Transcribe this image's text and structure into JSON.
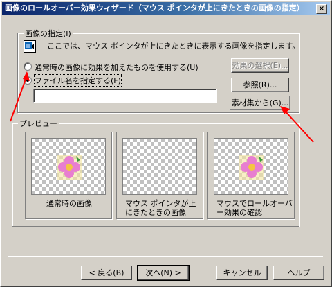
{
  "window": {
    "title": "画像のロールオーバー効果ウィザード（マウス ポインタが上にきたときの画像の指定）",
    "close_glyph": "×"
  },
  "image_spec": {
    "legend": "画像の指定(I)",
    "description": "ここでは、マウス ポインタが上にきたときに表示する画像を指定します。",
    "option_effect_label": "通常時の画像に効果を加えたものを使用する(U)",
    "option_file_label": "ファイル名を指定する(F)",
    "file_name_value": "",
    "effect_select_button": "効果の選択(E)...",
    "browse_button": "参照(R)...",
    "clipart_button": "素材集から(G)..."
  },
  "preview": {
    "legend": "プレビュー",
    "cells": [
      {
        "caption": "通常時の画像"
      },
      {
        "caption": "マウス ポインタが上にきたときの画像"
      },
      {
        "caption": "マウスでロールオーバー効果の確認"
      }
    ]
  },
  "footer": {
    "back": "< 戻る(B)",
    "next": "次へ(N) >",
    "cancel": "キャンセル",
    "help": "ヘルプ"
  },
  "colors": {
    "dialog_face": "#d4d0c8",
    "title_start": "#0a246a",
    "title_end": "#a6caf0",
    "arrow": "#ff0000"
  }
}
